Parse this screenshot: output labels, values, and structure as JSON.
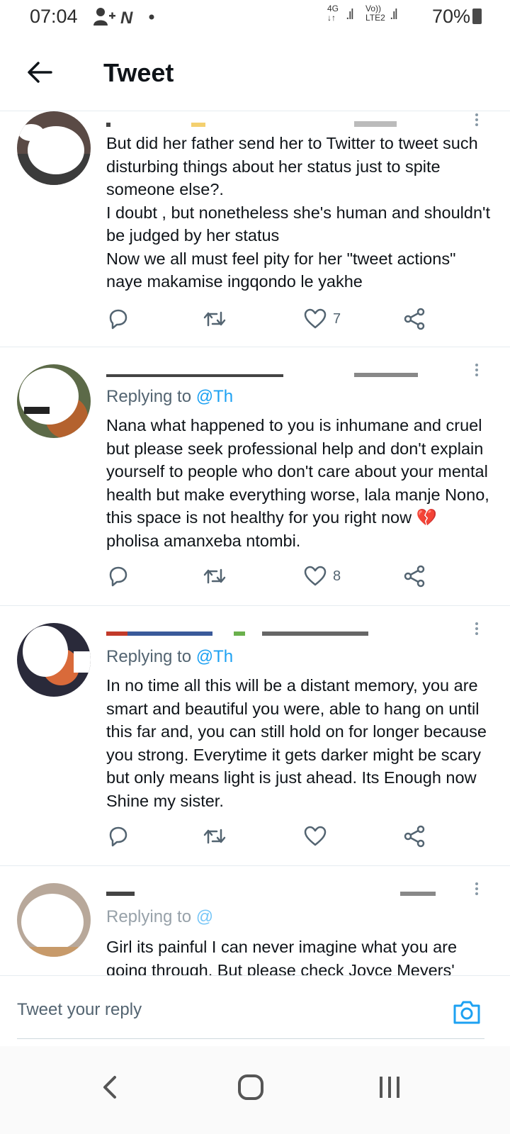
{
  "status_bar": {
    "time": "07:04",
    "network_4g": "4G",
    "network_volte": "Vo))",
    "network_lte2": "LTE2",
    "battery": "70%"
  },
  "header": {
    "title": "Tweet"
  },
  "tweets": [
    {
      "reply_prefix": "",
      "reply_handle": "",
      "body": "But did her father send her to Twitter to tweet such disturbing things about her status just to spite someone else?.\nI doubt , but nonetheless she's human and shouldn't be judged by her status\nNow we all must feel pity for her \"tweet actions\" naye makamise ingqondo le yakhe",
      "likes": "7"
    },
    {
      "reply_prefix": "Replying to ",
      "reply_handle": "@Th",
      "body": "Nana what happened to you is inhumane and cruel but please seek professional help and don't explain yourself to people who don't care about your mental health but make everything worse, lala manje Nono, this space is not healthy for you right now 💔 pholisa amanxeba ntombi.",
      "likes": "8"
    },
    {
      "reply_prefix": "Replying to ",
      "reply_handle": "@Th",
      "body": "In no time all this will be a distant memory, you are smart and beautiful you were, able to hang on until this far and, you can still hold on for longer because you strong. Everytime it gets darker might be scary but only means light is just ahead. Its Enough now Shine my sister.",
      "likes": ""
    },
    {
      "reply_prefix": "Replying to ",
      "reply_handle": "@",
      "body": "Girl its painful I can never imagine what you are going through. But please check Joyce Meyers'",
      "likes": ""
    }
  ],
  "composer": {
    "placeholder": "Tweet your reply"
  },
  "icons": {
    "accent": "#1da1f2",
    "action_gray": "#536471"
  }
}
